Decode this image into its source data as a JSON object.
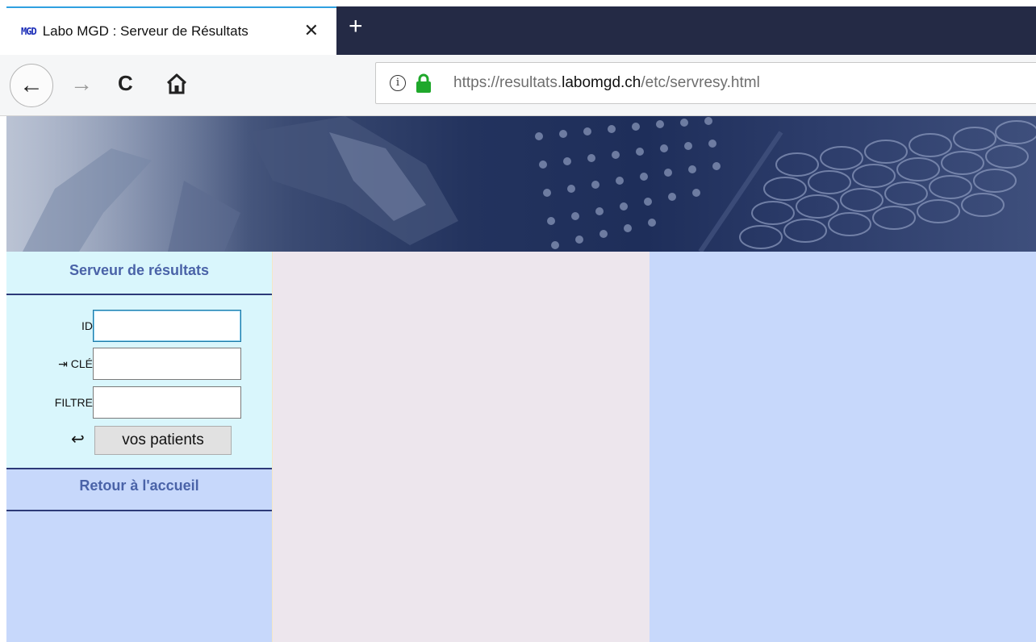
{
  "browser": {
    "tab": {
      "favicon_text": "MGD",
      "title": "Labo MGD : Serveur de Résultats",
      "close_glyph": "✕"
    },
    "new_tab_glyph": "+",
    "nav": {
      "back_glyph": "←",
      "forward_glyph": "→",
      "reload_glyph": "C",
      "home_icon": "home-icon"
    },
    "url": {
      "info_glyph": "i",
      "lock_color": "#1fa82b",
      "prefix": "https://resultats.",
      "domain": "labomgd.ch",
      "path": "/etc/servresy.html"
    }
  },
  "page": {
    "colors": {
      "panel_light": "#d9f6fc",
      "column_blue": "#c7d8fb",
      "column_mauve": "#ede6ed",
      "title_blue": "#4a63a8",
      "rule_navy": "#2d3a78"
    },
    "login": {
      "title": "Serveur de résultats",
      "id_label": "ID",
      "id_value": "",
      "key_label": "⇥ CLÉ",
      "key_value": "",
      "filter_label": "FILTRE",
      "filter_value": "",
      "submit_glyph": "↩",
      "submit_label": "vos patients"
    },
    "home_link": "Retour à l'accueil"
  }
}
